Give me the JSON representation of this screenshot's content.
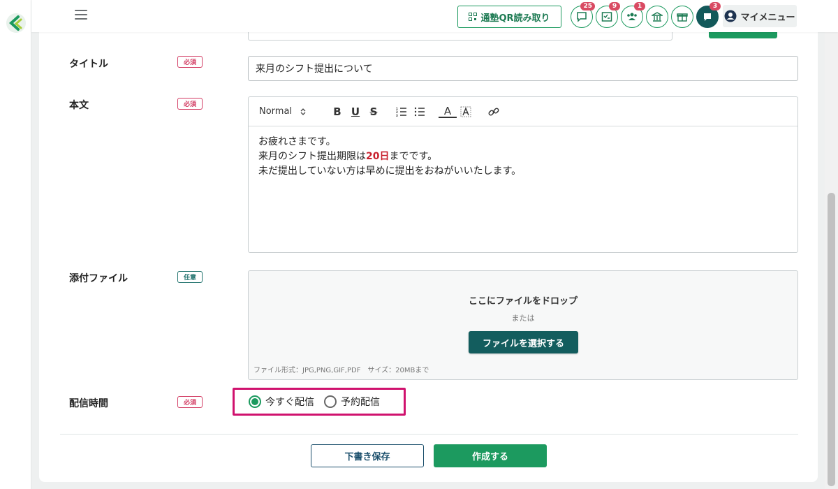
{
  "header": {
    "qr_button": "通塾QR読み取り",
    "icons": [
      {
        "name": "message-icon",
        "badge": "25"
      },
      {
        "name": "checklist-icon",
        "badge": "9"
      },
      {
        "name": "users-icon",
        "badge": "1"
      },
      {
        "name": "school-icon",
        "badge": ""
      },
      {
        "name": "gift-icon",
        "badge": ""
      },
      {
        "name": "chat-icon",
        "badge": "3"
      }
    ],
    "my_menu": "マイメニュー"
  },
  "form": {
    "title": {
      "label": "タイトル",
      "tag": "必須",
      "value": "来月のシフト提出について"
    },
    "body": {
      "label": "本文",
      "tag": "必須",
      "toolbar": {
        "format": "Normal",
        "bold": "B",
        "underline": "U",
        "strike": "S",
        "text_color": "A"
      },
      "line1": "お疲れさまです。",
      "line2_pre": "来月のシフト提出期限は",
      "line2_hl": "20日",
      "line2_post": "までです。",
      "line3": "未だ提出していない方は早めに提出をおねがいいたします。"
    },
    "attachment": {
      "label": "添付ファイル",
      "tag": "任意",
      "drop_text": "ここにファイルをドロップ",
      "or_text": "または",
      "select_button": "ファイルを選択する",
      "note": "ファイル形式：JPG,PNG,GIF,PDF　サイズ：20MBまで"
    },
    "delivery": {
      "label": "配信時間",
      "tag": "必須",
      "options": [
        "今すぐ配信",
        "予約配信"
      ],
      "selected": "今すぐ配信"
    }
  },
  "footer": {
    "draft_button": "下書き保存",
    "create_button": "作成する"
  },
  "colors": {
    "primary": "#1c9a5f",
    "dark_teal": "#135d5e",
    "required": "#d23b62",
    "highlight": "#d0126e"
  }
}
